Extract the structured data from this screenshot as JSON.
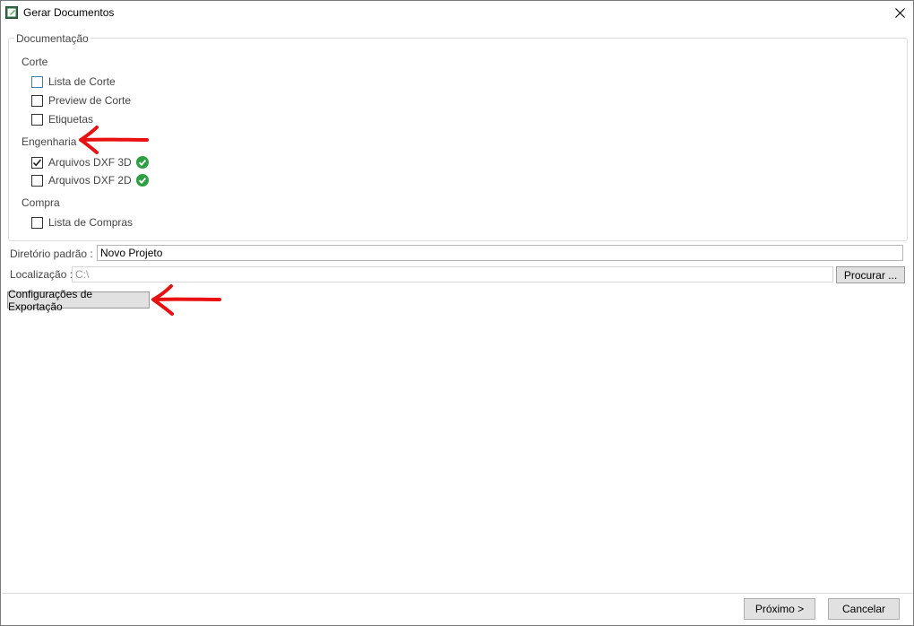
{
  "window": {
    "title": "Gerar Documentos"
  },
  "group": {
    "legend": "Documentação",
    "sections": [
      {
        "label": "Corte",
        "items": [
          {
            "label": "Lista de Corte",
            "checked": false
          },
          {
            "label": "Preview de Corte",
            "checked": false
          },
          {
            "label": "Etiquetas",
            "checked": false
          }
        ]
      },
      {
        "label": "Engenharia",
        "items": [
          {
            "label": "Arquivos DXF 3D",
            "checked": true,
            "status_icon": "green-check-icon"
          },
          {
            "label": "Arquivos DXF 2D",
            "checked": false,
            "status_icon": "green-check-icon"
          }
        ]
      },
      {
        "label": "Compra",
        "items": [
          {
            "label": "Lista de Compras",
            "checked": false
          }
        ]
      }
    ]
  },
  "form": {
    "directory_label": "Diretório padrão :",
    "directory_value": "Novo Projeto",
    "location_label": "Localização :",
    "location_value": "C:\\",
    "browse_label": "Procurar ...",
    "export_settings_label": "Configurações de Exportação"
  },
  "footer": {
    "next_label": "Próximo >",
    "cancel_label": "Cancelar"
  },
  "colors": {
    "annotation_arrow": "#e81010",
    "check_green": "#2ea043"
  }
}
